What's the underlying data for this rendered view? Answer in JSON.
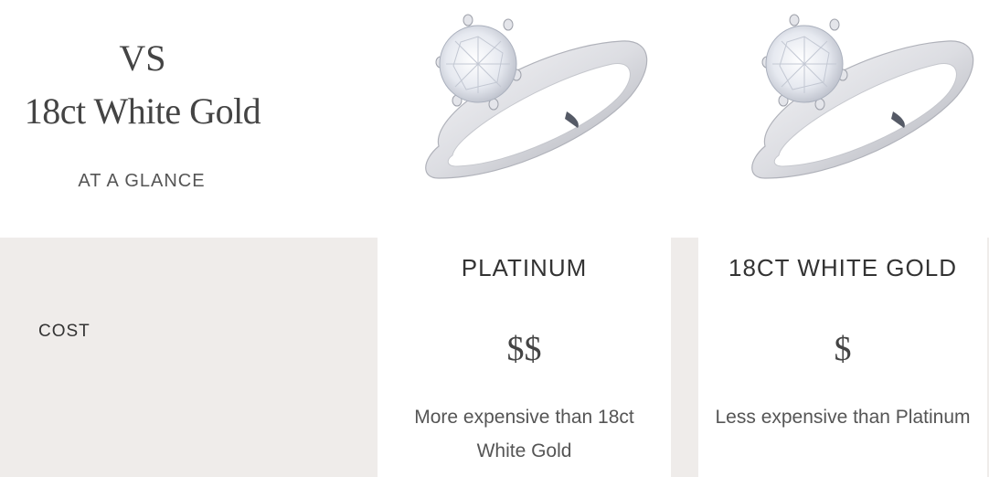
{
  "header": {
    "vs": "VS",
    "metal": "18ct White Gold",
    "subtitle": "AT A GLANCE"
  },
  "images": [
    {
      "name": "platinum-ring-image",
      "icon": "solitaire-ring"
    },
    {
      "name": "white-gold-ring-image",
      "icon": "solitaire-ring"
    }
  ],
  "table": {
    "row_label": "COST",
    "columns": [
      {
        "heading": "PLATINUM",
        "price": "$$",
        "description": "More expensive than 18ct White Gold"
      },
      {
        "heading": "18CT WHITE GOLD",
        "price": "$",
        "description": "Less expensive than Platinum"
      }
    ]
  },
  "colors": {
    "panel": "#efecea",
    "text": "#333333",
    "heading_serif": "#444444"
  }
}
